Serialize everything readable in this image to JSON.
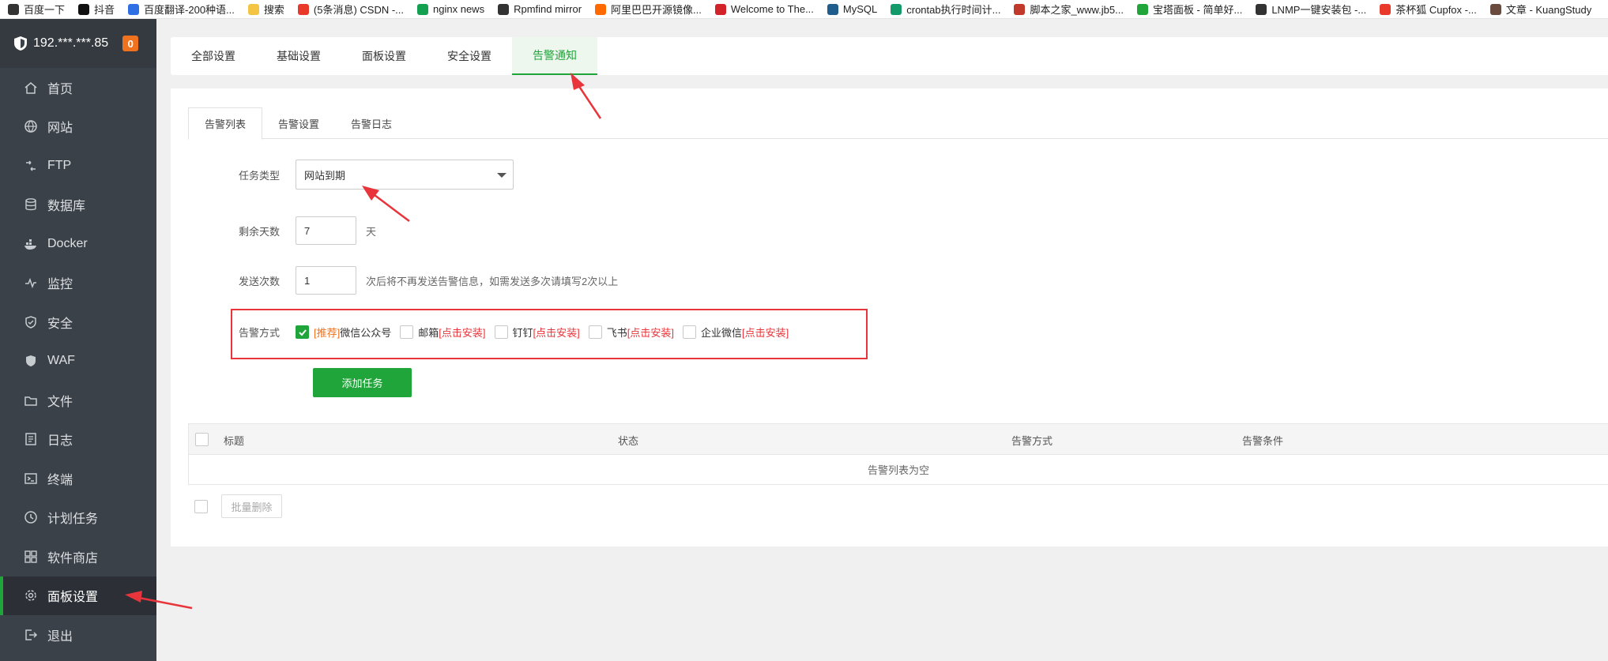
{
  "bookmarks": [
    {
      "label": "百度一下",
      "icon": "globe-icon",
      "color": "#333333"
    },
    {
      "label": "抖音",
      "icon": "tiktok-icon",
      "color": "#111111"
    },
    {
      "label": "百度翻译-200种语...",
      "icon": "translate-icon",
      "color": "#2f6fe4"
    },
    {
      "label": "搜索",
      "icon": "folder-icon",
      "color": "#f4c542"
    },
    {
      "label": "(5条消息) CSDN -...",
      "icon": "csdn-icon",
      "color": "#e8392a"
    },
    {
      "label": "nginx news",
      "icon": "nginx-icon",
      "color": "#14a051"
    },
    {
      "label": "Rpmfind mirror",
      "icon": "linux-icon",
      "color": "#333333"
    },
    {
      "label": "阿里巴巴开源镜像...",
      "icon": "aliyun-icon",
      "color": "#ff6a00"
    },
    {
      "label": "Welcome to The...",
      "icon": "feather-icon",
      "color": "#d2232a"
    },
    {
      "label": "MySQL",
      "icon": "mysql-icon",
      "color": "#1f5d8c"
    },
    {
      "label": "crontab执行时间计...",
      "icon": "crontab-icon",
      "color": "#139a6a"
    },
    {
      "label": "脚本之家_www.jb5...",
      "icon": "jb51-icon",
      "color": "#c0392b"
    },
    {
      "label": "宝塔面板 - 简单好...",
      "icon": "bt-icon",
      "color": "#20a53a"
    },
    {
      "label": "LNMP一键安装包 -...",
      "icon": "globe-icon",
      "color": "#333333"
    },
    {
      "label": "茶杯狐 Cupfox -...",
      "icon": "cupfox-icon",
      "color": "#e8392a"
    },
    {
      "label": "文章 - KuangStudy",
      "icon": "kuang-icon",
      "color": "#6b4b3e"
    }
  ],
  "sidebar": {
    "server": "192.***.***.85",
    "badge": "0",
    "items": [
      {
        "label": "首页",
        "icon": "home-icon"
      },
      {
        "label": "网站",
        "icon": "globe-icon"
      },
      {
        "label": "FTP",
        "icon": "ftp-icon"
      },
      {
        "label": "数据库",
        "icon": "database-icon"
      },
      {
        "label": "Docker",
        "icon": "docker-icon"
      },
      {
        "label": "监控",
        "icon": "monitor-icon"
      },
      {
        "label": "安全",
        "icon": "shield-icon"
      },
      {
        "label": "WAF",
        "icon": "waf-icon"
      },
      {
        "label": "文件",
        "icon": "folder-icon"
      },
      {
        "label": "日志",
        "icon": "log-icon"
      },
      {
        "label": "终端",
        "icon": "terminal-icon"
      },
      {
        "label": "计划任务",
        "icon": "clock-icon"
      },
      {
        "label": "软件商店",
        "icon": "apps-icon"
      },
      {
        "label": "面板设置",
        "icon": "gear-icon"
      },
      {
        "label": "退出",
        "icon": "logout-icon"
      }
    ],
    "active_index": 13
  },
  "top_tabs": [
    "全部设置",
    "基础设置",
    "面板设置",
    "安全设置",
    "告警通知"
  ],
  "top_tab_active": 4,
  "sub_tabs": [
    "告警列表",
    "告警设置",
    "告警日志"
  ],
  "sub_tab_active": 0,
  "form": {
    "task_type_label": "任务类型",
    "task_type_value": "网站到期",
    "days_label": "剩余天数",
    "days_value": "7",
    "days_unit": "天",
    "send_label": "发送次数",
    "send_value": "1",
    "send_hint": "次后将不再发送告警信息，如需发送多次请填写2次以上",
    "method_label": "告警方式",
    "methods": [
      {
        "prefix": "[推荐]",
        "name": "微信公众号",
        "suffix": "",
        "checked": true
      },
      {
        "prefix": "",
        "name": "邮箱",
        "suffix": "[点击安装]",
        "checked": false
      },
      {
        "prefix": "",
        "name": "钉钉",
        "suffix": "[点击安装]",
        "checked": false
      },
      {
        "prefix": "",
        "name": "飞书",
        "suffix": "[点击安装]",
        "checked": false
      },
      {
        "prefix": "",
        "name": "企业微信",
        "suffix": "[点击安装]",
        "checked": false
      }
    ],
    "add_button": "添加任务"
  },
  "table": {
    "columns": [
      "标题",
      "状态",
      "告警方式",
      "告警条件"
    ],
    "empty": "告警列表为空",
    "bulk_delete": "批量删除"
  },
  "colors": {
    "accent": "#20a53a",
    "sidebar_bg": "#3b4148",
    "highlight": "#e8353b",
    "badge": "#f0721f"
  }
}
